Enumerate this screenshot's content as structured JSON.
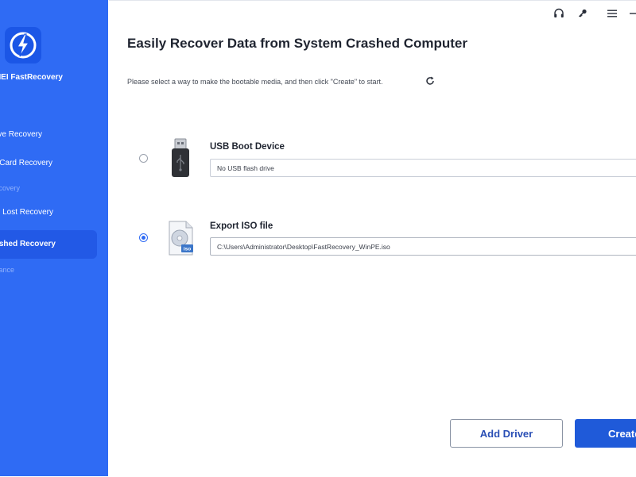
{
  "sidebar": {
    "app_name": "IMEI FastRecovery",
    "items": [
      {
        "label": "Drive Recovery"
      },
      {
        "label": "SD Card Recovery"
      },
      {
        "label": "Recovery"
      },
      {
        "label": "ion Lost Recovery"
      },
      {
        "label": "Crashed Recovery"
      },
      {
        "label": "stance"
      }
    ]
  },
  "topbar": {
    "icons": [
      "headset-icon",
      "key-icon",
      "menu-icon",
      "minimize-icon"
    ]
  },
  "main": {
    "title": "Easily Recover Data from System Crashed Computer",
    "instructions": "Please select a way to make the bootable media, and then click \"Create\" to start.",
    "options": [
      {
        "label": "USB Boot Device",
        "value": "No USB flash drive",
        "selected": false,
        "icon": "usb-drive-icon"
      },
      {
        "label": "Export ISO file",
        "value": "C:\\Users\\Administrator\\Desktop\\FastRecovery_WinPE.iso",
        "selected": true,
        "icon": "iso-file-icon"
      }
    ],
    "buttons": {
      "add_driver": "Add Driver",
      "create": "Create"
    }
  },
  "colors": {
    "sidebar": "#2f6bf4",
    "sidebar_active": "#2259e6",
    "primary_button": "#1f5ad9",
    "accent": "#2f6bf4"
  }
}
